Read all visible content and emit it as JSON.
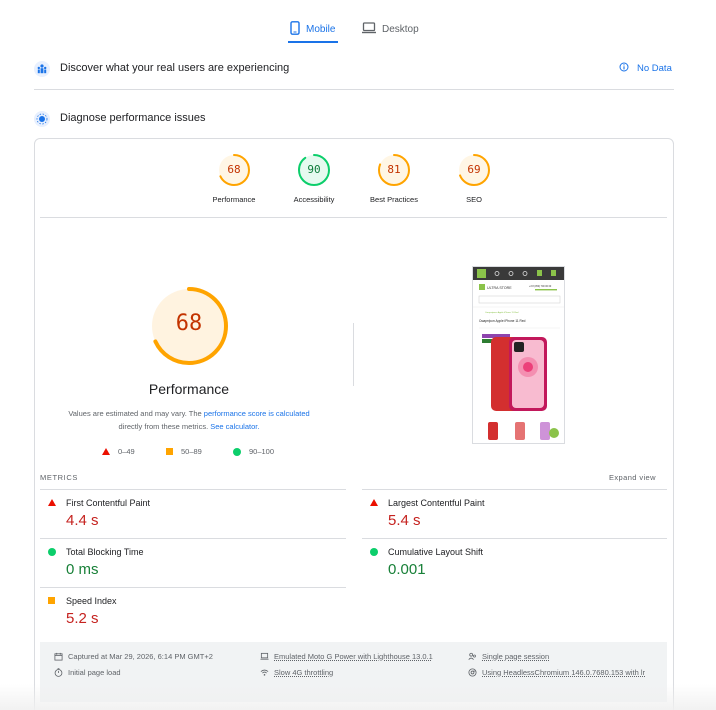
{
  "tabs": {
    "mobile": "Mobile",
    "desktop": "Desktop"
  },
  "field": {
    "title": "Discover what your real users are experiencing",
    "no_data": "No Data"
  },
  "diagnose": {
    "title": "Diagnose performance issues"
  },
  "scores": [
    {
      "label": "Performance",
      "value": "68",
      "color": "#ffa400",
      "text_color": "#c33300",
      "fraction": 0.68
    },
    {
      "label": "Accessibility",
      "value": "90",
      "color": "#0cce6b",
      "text_color": "#0d7c3b",
      "fraction": 0.9
    },
    {
      "label": "Best Practices",
      "value": "81",
      "color": "#ffa400",
      "text_color": "#c33300",
      "fraction": 0.81
    },
    {
      "label": "SEO",
      "value": "69",
      "color": "#ffa400",
      "text_color": "#c33300",
      "fraction": 0.69
    }
  ],
  "main": {
    "score": "68",
    "fraction": 0.68,
    "title": "Performance",
    "desc_prefix": "Values are estimated and may vary. The ",
    "desc_link1": "performance score is calculated",
    "desc_mid": " directly from these metrics. ",
    "desc_link2": "See calculator."
  },
  "legend": {
    "fail": "0–49",
    "average": "50–89",
    "pass": "90–100"
  },
  "metrics": {
    "label": "METRICS",
    "expand": "Expand view",
    "fcp": {
      "name": "First Contentful Paint",
      "value": "4.4 s"
    },
    "lcp": {
      "name": "Largest Contentful Paint",
      "value": "5.4 s"
    },
    "tbt": {
      "name": "Total Blocking Time",
      "value": "0 ms"
    },
    "cls": {
      "name": "Cumulative Layout Shift",
      "value": "0.001"
    },
    "si": {
      "name": "Speed Index",
      "value": "5.2 s"
    }
  },
  "thumbnail": {
    "logo": "ULTRA STORE",
    "phone_number": "+3 8 (050) 700 00 00",
    "breadcrumb": "Смартфоны Apple iPhone 11 Red",
    "product_title": "Смартфон Apple iPhone 11 Red"
  },
  "footer": {
    "captured": "Captured at Mar 29, 2026, 6:14 PM GMT+2",
    "initial": "Initial page load",
    "emulated": "Emulated Moto G Power with Lighthouse 13.0.1",
    "throttling": "Slow 4G throttling",
    "session": "Single page session",
    "browser": "Using HeadlessChromium 146.0.7680.153 with lr"
  },
  "colors": {
    "accent": "#1a73e8",
    "fail": "#eb0f00",
    "average": "#ffa400",
    "pass": "#0cce6b"
  }
}
